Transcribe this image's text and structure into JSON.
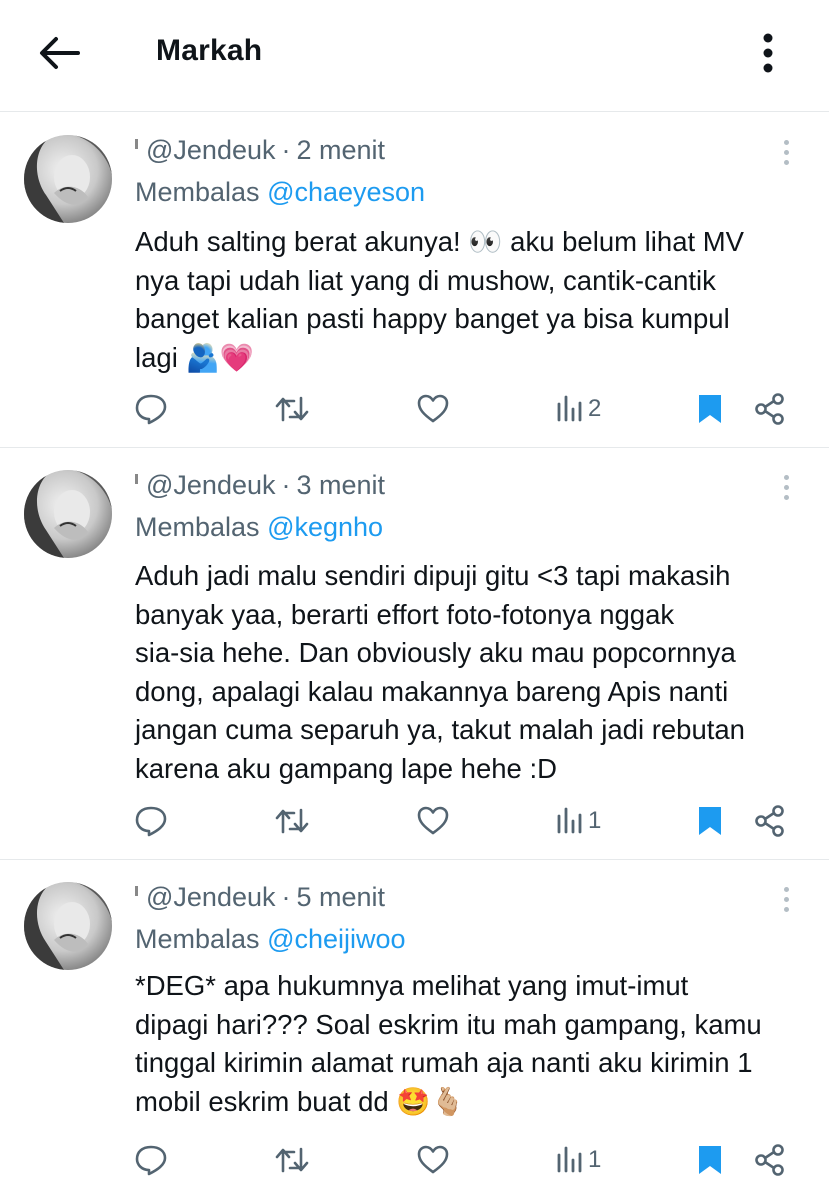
{
  "header": {
    "title": "Markah"
  },
  "posts": [
    {
      "handle": "@Jendeuk",
      "separator": "·",
      "time": "2 menit",
      "reply_prefix": "Membalas",
      "reply_to": "@chaeyeson",
      "lines": [
        "Aduh salting berat akunya! 👀 aku belum lihat MV",
        "nya tapi udah liat yang di mushow, cantik-cantik",
        "banget kalian pasti happy banget ya bisa kumpul",
        "lagi 🫂💗"
      ],
      "views": "2"
    },
    {
      "handle": "@Jendeuk",
      "separator": "·",
      "time": "3 menit",
      "reply_prefix": "Membalas",
      "reply_to": "@kegnho",
      "lines": [
        "Aduh jadi malu sendiri dipuji gitu <3 tapi makasih",
        "banyak yaa, berarti effort foto-fotonya nggak",
        "sia-sia hehe. Dan obviously aku mau popcornnya",
        "dong, apalagi kalau makannya bareng Apis nanti",
        "jangan cuma separuh ya, takut malah jadi rebutan",
        "karena aku gampang lape hehe :D"
      ],
      "views": "1"
    },
    {
      "handle": "@Jendeuk",
      "separator": "·",
      "time": "5 menit",
      "reply_prefix": "Membalas",
      "reply_to": "@cheijiwoo",
      "lines": [
        "*DEG* apa hukumnya melihat yang imut-imut",
        "dipagi hari??? Soal eskrim itu mah gampang, kamu",
        "tinggal kirimin alamat rumah aja nanti aku kirimin 1",
        "mobil eskrim buat dd 🤩🫰🏼"
      ],
      "views": "1"
    }
  ],
  "colors": {
    "link": "#1d9bf0",
    "secondary_text": "#536471",
    "divider": "#e6e9eb",
    "bookmark_active": "#1d9bf0"
  },
  "icons": [
    "back-arrow-icon",
    "more-vertical-icon",
    "reply-icon",
    "retweet-icon",
    "like-icon",
    "views-icon",
    "bookmark-icon",
    "share-icon"
  ]
}
